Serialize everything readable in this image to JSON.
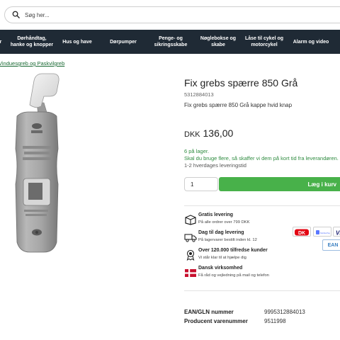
{
  "search": {
    "placeholder": "Søg her..."
  },
  "nav": {
    "items": [
      {
        "label": "r"
      },
      {
        "label": "Dørhåndtag,\nhanke og knopper"
      },
      {
        "label": "Hus og have"
      },
      {
        "label": "Dørpumper"
      },
      {
        "label": "Penge- og\nsikringsskabe"
      },
      {
        "label": "Nøglebokse og\nskabe"
      },
      {
        "label": "Låse til cykel og\nmotorcykel"
      },
      {
        "label": "Alarm og video"
      }
    ]
  },
  "breadcrumb": {
    "label": "Vinduesgreb og Paskvilgreb"
  },
  "product": {
    "title": "Fix grebs spærre 850 Grå",
    "sku": "5312884013",
    "description": "Fix grebs spærre 850 Grå kappe hvid knap",
    "currency": "DKK",
    "price": "136,00",
    "stock_line1": "6 på lager.",
    "stock_line2": "Skal du bruge flere, så skaffer vi dem på kort tid fra leverandøren.",
    "delivery": "1-2 hverdages leveringstid",
    "quantity": "1",
    "add_to_cart": "Læg i kurv"
  },
  "features": [
    {
      "icon": "box-icon",
      "title": "Gratis levering",
      "subtitle": "På alle ordrer over 799 DKK"
    },
    {
      "icon": "truck-icon",
      "title": "Dag til dag levering",
      "subtitle": "På lagervarer bestilt inden kl. 12"
    },
    {
      "icon": "award-icon",
      "title": "Over 120.000 tilfredse kunder",
      "subtitle": "Vi står klar til at hjælpe dig"
    },
    {
      "icon": "danish-flag-icon",
      "title": "Dansk virksomhed",
      "subtitle": "Få råd og vejledning på mail og telefon"
    }
  ],
  "payment": {
    "dankort": "DK",
    "mobilepay": "MobilePay",
    "visa": "VI",
    "ean": "EAN",
    "colors": {
      "dankort": "#e30613",
      "mobilepay": "#5a78ff",
      "visa": "#1a1f71"
    }
  },
  "specs": [
    {
      "label": "EAN/GLN nummer",
      "value": "9995312884013"
    },
    {
      "label": "Producent varenummer",
      "value": "9511998"
    }
  ],
  "colors": {
    "nav_bg": "#1f2a35",
    "accent_green": "#48b14a",
    "stock_green": "#2e8b3f",
    "link_green": "#1a6a34"
  }
}
